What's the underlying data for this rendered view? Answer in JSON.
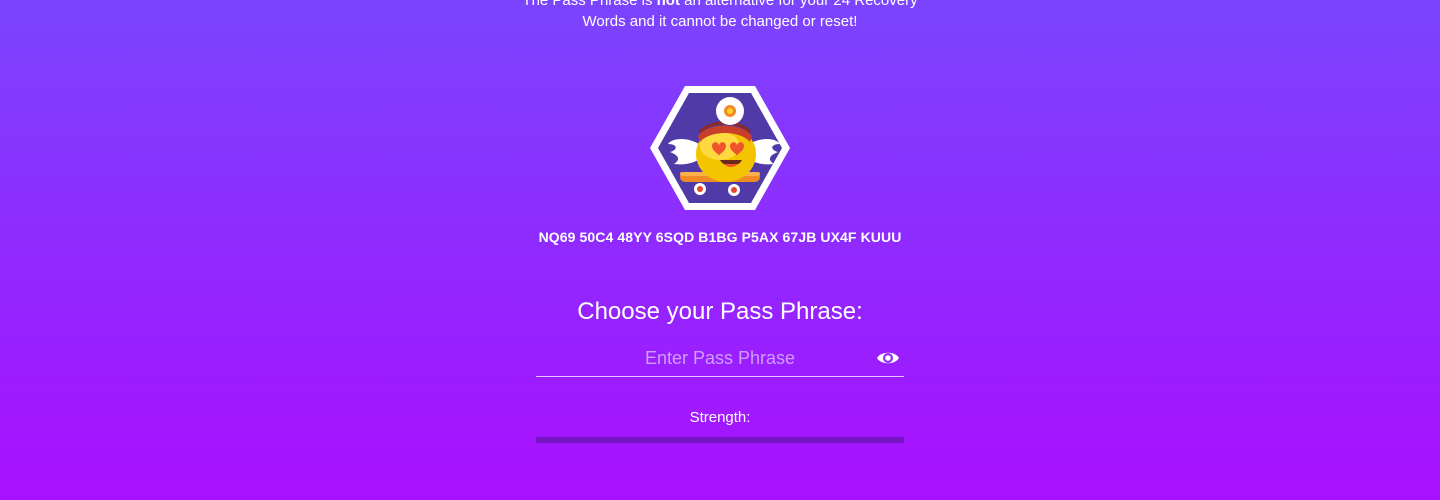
{
  "notice": {
    "line1_pre": "The Pass Phrase is ",
    "line1_bold": "not",
    "line1_post": " an alternative for your 24 Recovery",
    "line2": "Words and it cannot be changed or reset!"
  },
  "wallet": {
    "avatar_icon": "nimiq-identicon-avatar",
    "address": "NQ69 50C4 48YY 6SQD B1BG P5AX 67JB UX4F KUUU"
  },
  "passphrase": {
    "title": "Choose your Pass Phrase:",
    "placeholder": "Enter Pass Phrase",
    "value": "",
    "toggle_icon": "eye-icon"
  },
  "strength": {
    "label": "Strength:",
    "level": 0
  },
  "colors": {
    "background_top": "#7b44ff",
    "background_bottom": "#a910ff",
    "hexagon_fill": "#4f3aa8",
    "strength_track": "#7614c4"
  }
}
